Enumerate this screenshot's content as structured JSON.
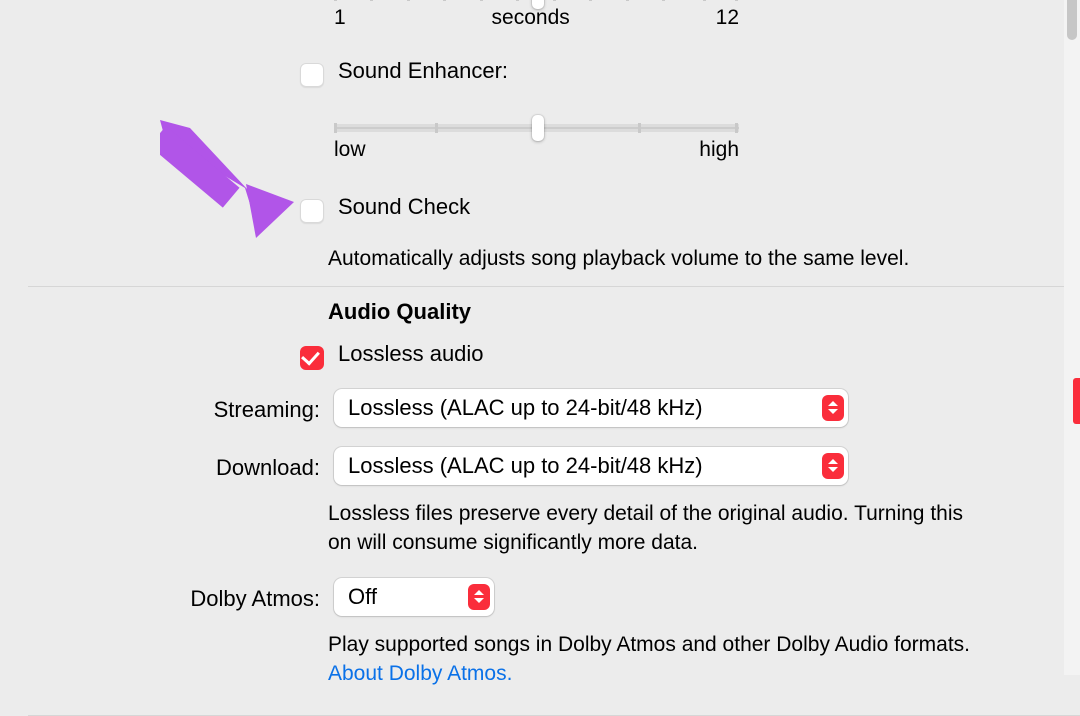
{
  "crossfade": {
    "min_label": "1",
    "unit_label": "seconds",
    "max_label": "12"
  },
  "sound_enhancer": {
    "label": "Sound Enhancer:",
    "low_label": "low",
    "high_label": "high"
  },
  "sound_check": {
    "label": "Sound Check",
    "help": "Automatically adjusts song playback volume to the same level."
  },
  "audio_quality": {
    "title": "Audio Quality",
    "lossless_label": "Lossless audio",
    "streaming_label": "Streaming:",
    "streaming_value": "Lossless (ALAC up to 24-bit/48 kHz)",
    "download_label": "Download:",
    "download_value": "Lossless (ALAC up to 24-bit/48 kHz)",
    "lossless_help": "Lossless files preserve every detail of the original audio. Turning this on will consume significantly more data.",
    "dolby_label": "Dolby Atmos:",
    "dolby_value": "Off",
    "dolby_help": "Play supported songs in Dolby Atmos and other Dolby Audio formats.",
    "dolby_link": "About Dolby Atmos."
  }
}
